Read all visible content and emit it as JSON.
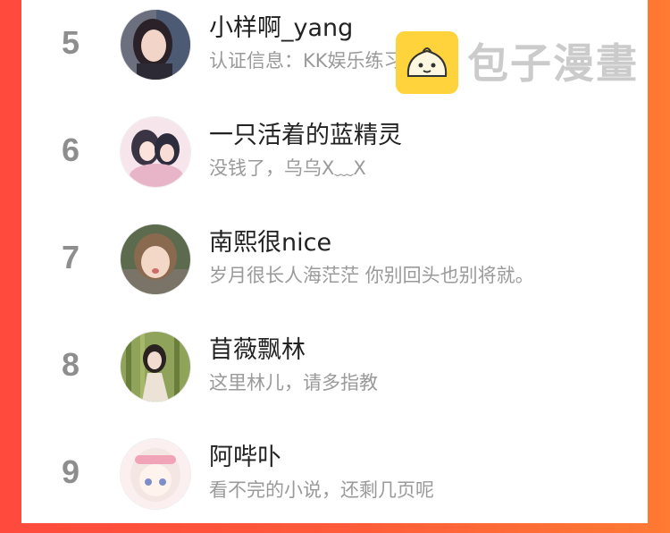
{
  "rows": [
    {
      "rank": "5",
      "name": "小样啊_yang",
      "bio": "认证信息：KK娱乐练习生"
    },
    {
      "rank": "6",
      "name": "一只活着的蓝精灵",
      "bio": "没钱了，乌乌X﹏X"
    },
    {
      "rank": "7",
      "name": "南熙很nice",
      "bio": "岁月很长人海茫茫 你别回头也别将就。"
    },
    {
      "rank": "8",
      "name": "苜薇飘林",
      "bio": "这里林儿，请多指教"
    },
    {
      "rank": "9",
      "name": "阿哔卟",
      "bio": "看不完的小说，还剩几页呢"
    }
  ],
  "watermark": {
    "text": "包子漫畫",
    "icon": "bun-logo-icon"
  },
  "colors": {
    "accent_left": "#ff4a3d",
    "accent_right": "#ff7a33",
    "watermark_bg": "#ffd33c"
  }
}
